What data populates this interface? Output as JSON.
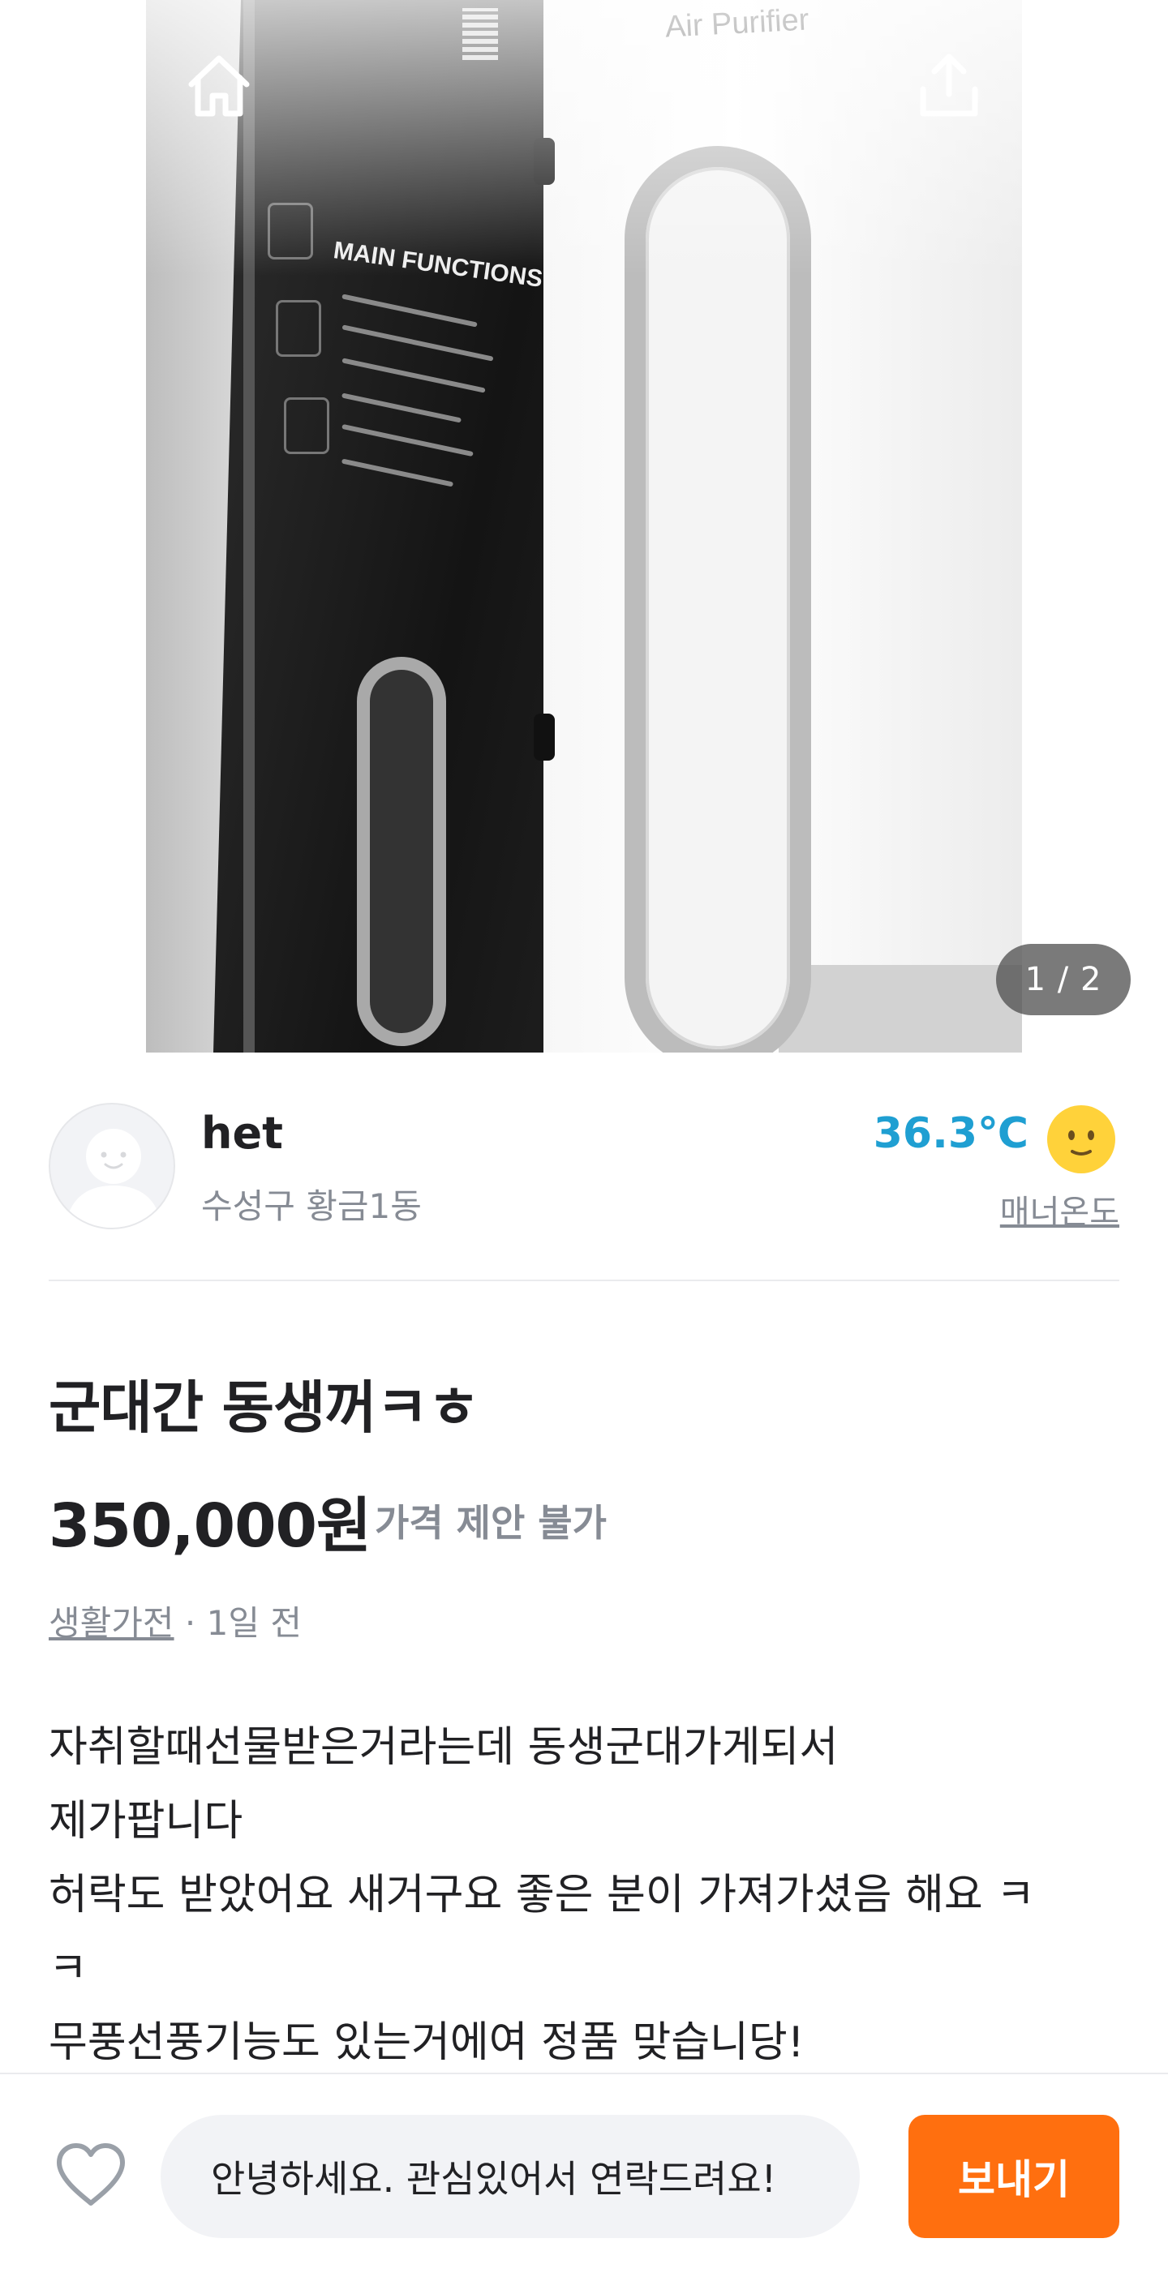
{
  "colors": {
    "accent_orange": "#ff6f0f",
    "temperature_blue": "#1f9fd2",
    "text_primary": "#212124",
    "text_secondary": "#868b94"
  },
  "icons": {
    "back": "chevron-left-icon",
    "home": "home-icon",
    "share": "share-icon",
    "more": "more-vertical-icon",
    "temperature_face": "smile-face-icon",
    "like": "heart-icon"
  },
  "photo": {
    "brand_text": "Air Purifier",
    "functions_text": "MAIN FUNCTIONS",
    "counter": "1 / 2"
  },
  "seller": {
    "name": "het",
    "region": "수성구 황금1동",
    "temperature": "36.3℃",
    "manner_label": "매너온도"
  },
  "product": {
    "title": "군대간 동생꺼ㅋㅎ",
    "price": "350,000원",
    "price_note": "가격 제안 불가",
    "category": "생활가전",
    "time": "· 1일 전",
    "description_lines": [
      "자취할때선물받은거라는데 동생군대가게되서",
      "제가팝니다",
      "허락도 받았어요 새거구요 좋은 분이 가져가셨음 해요 ㅋ",
      "ㅋ",
      "무풍선풍기능도 있는거에여  정품 맞습니당!"
    ]
  },
  "chat": {
    "message": "안녕하세요. 관심있어서 연락드려요!",
    "send_label": "보내기"
  }
}
